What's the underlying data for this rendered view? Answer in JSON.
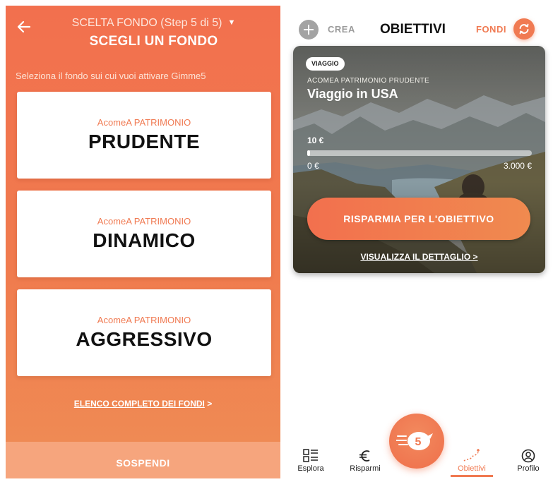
{
  "left_screen": {
    "step_title": "SCELTA FONDO (Step 5 di 5)",
    "main_title": "SCEGLI UN FONDO",
    "subtitle": "Seleziona il fondo sui cui vuoi attivare Gimme5",
    "funds": [
      {
        "category": "AcomeA PATRIMONIO",
        "name": "PRUDENTE"
      },
      {
        "category": "AcomeA PATRIMONIO",
        "name": "DINAMICO"
      },
      {
        "category": "AcomeA PATRIMONIO",
        "name": "AGGRESSIVO"
      }
    ],
    "full_list_link": "ELENCO COMPLETO DEI FONDI",
    "full_list_chevron": ">",
    "suspend_label": "SOSPENDI"
  },
  "right_screen": {
    "header": {
      "create_label": "CREA",
      "title": "OBIETTIVI",
      "funds_label": "FONDI"
    },
    "goal": {
      "tag": "VIAGGIO",
      "fund": "ACOMEA PATRIMONIO PRUDENTE",
      "name": "Viaggio in USA",
      "current_amount": "10 €",
      "progress_fraction": 0.0033,
      "min_label": "0 €",
      "max_label": "3.000 €",
      "save_button": "RISPARMIA PER L'OBIETTIVO",
      "detail_link": "VISUALIZZA IL DETTAGLIO >"
    },
    "nav": {
      "esplora": "Esplora",
      "risparmi": "Risparmi",
      "center_number": "5",
      "obiettivi": "Obiettivi",
      "profilo": "Profilo"
    }
  },
  "colors": {
    "accent": "#f07a52",
    "left_background": "#f2704e",
    "suspend_bar": "#f6a57d"
  }
}
